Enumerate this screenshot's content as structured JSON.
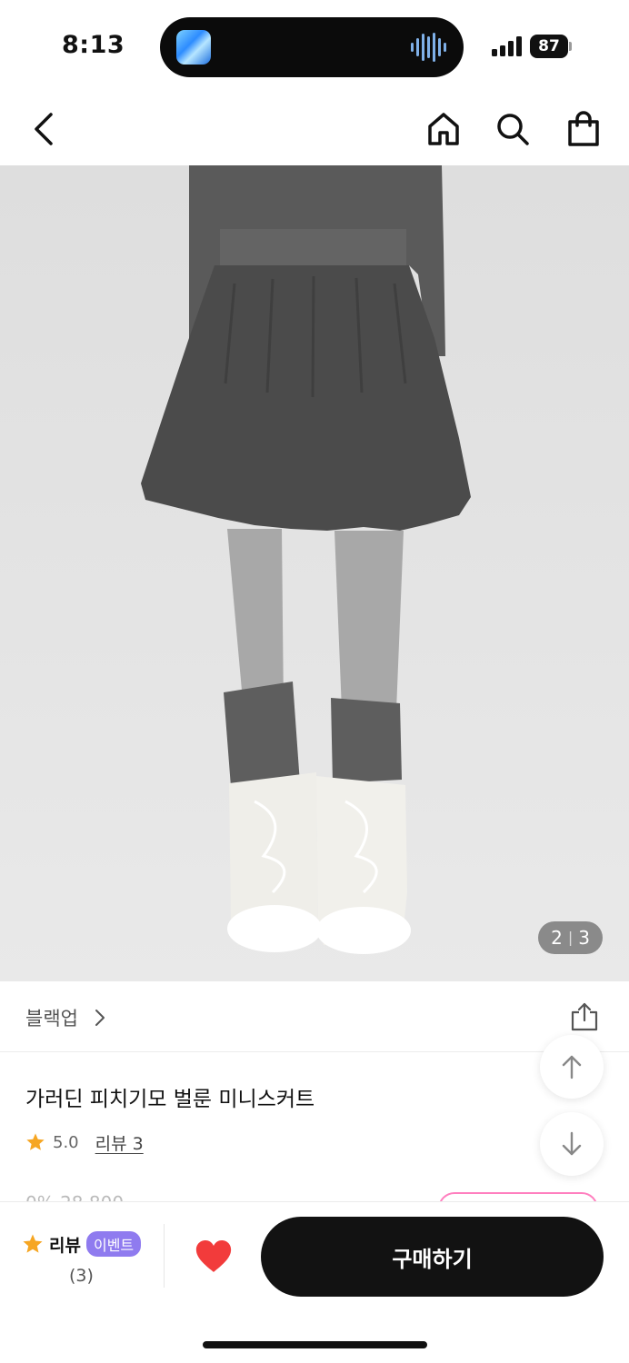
{
  "status_bar": {
    "time": "8:13",
    "battery": "87",
    "icons": [
      "app-thumbnail-icon",
      "audio-waveform-icon",
      "cellular-signal-icon",
      "battery-icon"
    ]
  },
  "nav": {
    "icons": [
      "back-chevron-icon",
      "home-icon",
      "search-icon",
      "shopping-bag-icon"
    ]
  },
  "image": {
    "current": "2",
    "total": "3",
    "separator": "|"
  },
  "brand": {
    "name": "블랙업",
    "icons": [
      "chevron-right-icon",
      "share-icon"
    ]
  },
  "product": {
    "title": "가러딘 피치기모 벌룬 미니스커트",
    "rating": "5.0",
    "review_link": "리뷰 3",
    "price_peek": "0% 28,800"
  },
  "bottom_bar": {
    "review_label": "리뷰",
    "event_badge": "이벤트",
    "review_count": "(3)",
    "buy_label": "구매하기"
  },
  "colors": {
    "star": "#f6a623",
    "heart": "#f23b3b",
    "event_badge": "#8f7bef",
    "buy_button": "#121212",
    "coupon_outline": "#ff7fbf"
  }
}
